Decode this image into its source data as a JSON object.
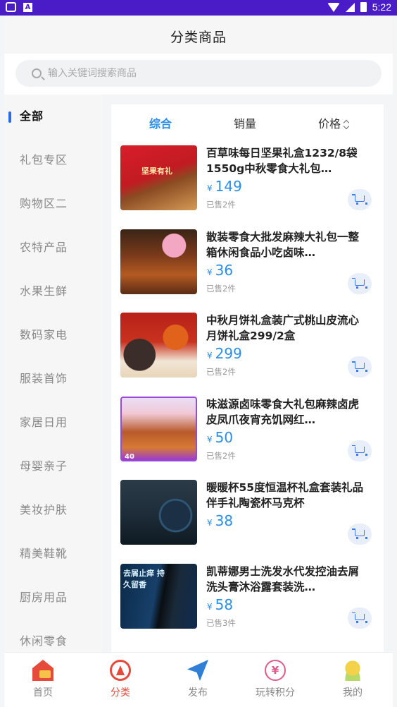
{
  "status_bar": {
    "time": "5:22",
    "app_glyph": "A"
  },
  "header": {
    "title": "分类商品"
  },
  "search": {
    "placeholder": "输入关键词搜索商品"
  },
  "sidebar": {
    "items": [
      {
        "label": "全部",
        "active": true
      },
      {
        "label": "礼包专区"
      },
      {
        "label": "购物区二"
      },
      {
        "label": "农特产品"
      },
      {
        "label": "水果生鲜"
      },
      {
        "label": "数码家电"
      },
      {
        "label": "服装首饰"
      },
      {
        "label": "家居日用"
      },
      {
        "label": "母婴亲子"
      },
      {
        "label": "美妆护肤"
      },
      {
        "label": "精美鞋靴"
      },
      {
        "label": "厨房用品"
      },
      {
        "label": "休闲零食"
      }
    ]
  },
  "sort_tabs": [
    {
      "label": "综合",
      "active": true
    },
    {
      "label": "销量"
    },
    {
      "label": "价格"
    }
  ],
  "currency": "¥",
  "products": [
    {
      "name": "百草味每日坚果礼盒1232/8袋1550g中秋零食大礼包…",
      "price": "149",
      "sold": "已售2件",
      "image_tag": "坚果有礼"
    },
    {
      "name": "散装零食大批发麻辣大礼包一整箱休闲食品小吃卤味…",
      "price": "36",
      "sold": "已售2件",
      "image_tag": ""
    },
    {
      "name": "中秋月饼礼盒装广式桃山皮流心月饼礼盒299/2盒",
      "price": "299",
      "sold": "已售2件",
      "image_tag": ""
    },
    {
      "name": "味滋源卤味零食大礼包麻辣卤虎皮凤爪夜宵充饥网红…",
      "price": "50",
      "sold": "已售2件",
      "image_tag": "40"
    },
    {
      "name": "暖暖杯55度恒温杯礼盒套装礼品伴手礼陶瓷杯马克杯",
      "price": "38",
      "sold": "",
      "image_tag": ""
    },
    {
      "name": "凯蒂娜男士洗发水代发控油去屑洗头膏沐浴露套装洗…",
      "price": "58",
      "sold": "已售3件",
      "image_tag": "去屑止痒 持久留香"
    }
  ],
  "tabbar": [
    {
      "label": "首页",
      "icon": "home-icon"
    },
    {
      "label": "分类",
      "icon": "category-icon",
      "active": true
    },
    {
      "label": "发布",
      "icon": "paper-plane-icon"
    },
    {
      "label": "玩转积分",
      "icon": "points-icon",
      "glyph": "¥"
    },
    {
      "label": "我的",
      "icon": "profile-icon"
    }
  ],
  "colors": {
    "status_bar": "#4a1cc8",
    "accent_blue": "#2b8ee6",
    "tab_active": "#e04a3a"
  }
}
